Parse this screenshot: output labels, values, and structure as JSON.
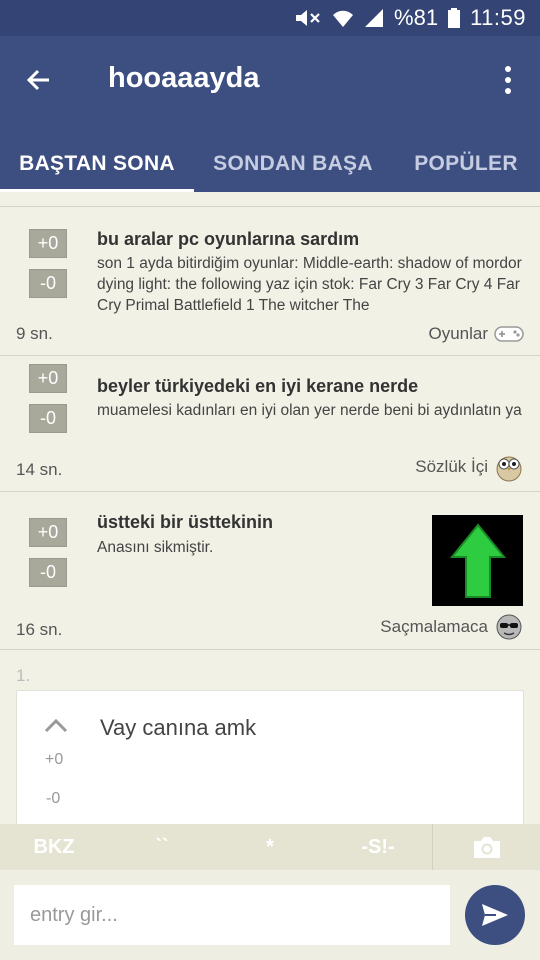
{
  "status_bar": {
    "battery": "%81",
    "time": "11:59"
  },
  "app_bar": {
    "title": "hooaaayda"
  },
  "tabs": [
    {
      "label": "BAŞTAN SONA",
      "active": true
    },
    {
      "label": "SONDAN BAŞA",
      "active": false
    },
    {
      "label": "POPÜLER",
      "active": false
    }
  ],
  "entries": [
    {
      "upvote": "+0",
      "downvote": "-0",
      "title": "bu aralar pc oyunlarına sardım",
      "body": "son 1 ayda bitirdiğim oyunlar: Middle-earth: shadow of mordor dying light: the following yaz için stok: Far Cry 3 Far Cry 4 Far Cry Primal Battlefield 1 The witcher The",
      "time": "9 sn.",
      "category": "Oyunlar",
      "category_icon": "gamepad-icon"
    },
    {
      "upvote": "+0",
      "downvote": "-0",
      "title": "beyler türkiyedeki en iyi kerane nerde",
      "body": "muamelesi kadınları en iyi olan yer nerde beni bi aydınlatın ya",
      "time": "14 sn.",
      "category": "Sözlük İçi",
      "category_icon": "owl-icon"
    },
    {
      "upvote": "+0",
      "downvote": "-0",
      "title": "üstteki bir üsttekinin",
      "body": "Anasını sikmiştir.",
      "time": "16 sn.",
      "category": "Saçmalamaca",
      "category_icon": "sunglasses-face-icon",
      "thumbnail_icon": "green-up-arrow-icon"
    }
  ],
  "reply": {
    "number": "1.",
    "text": "Vay canına amk",
    "upvote": "+0",
    "downvote": "-0"
  },
  "toolbar": {
    "bkz": "BKZ",
    "backtick": "``",
    "star": "*",
    "spoiler": "-S!-",
    "camera_icon": "camera-icon"
  },
  "composer": {
    "placeholder": "entry gir...",
    "value": ""
  },
  "colors": {
    "primary": "#3d4e80",
    "status": "#344474",
    "background": "#f2f1e6",
    "vote": "#a8a99a",
    "thumb_arrow": "#2ecc40"
  }
}
